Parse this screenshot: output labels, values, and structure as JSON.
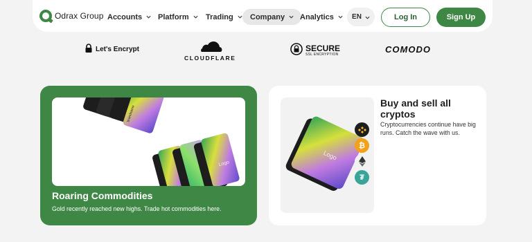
{
  "brand": {
    "name": "Odrax Group"
  },
  "nav": {
    "items": [
      {
        "label": "Accounts",
        "active": false
      },
      {
        "label": "Platform",
        "active": false
      },
      {
        "label": "Trading",
        "active": false
      },
      {
        "label": "Company",
        "active": true
      },
      {
        "label": "Analytics",
        "active": false
      }
    ],
    "language": "EN",
    "login_label": "Log In",
    "signup_label": "Sign Up"
  },
  "partners": {
    "letsencrypt": "Let's Encrypt",
    "cloudflare": "CLOUDFLARE",
    "secure_big": "SECURE",
    "secure_small": "SSL ENCRYPTION",
    "comodo": "COMODO"
  },
  "cards": {
    "commodities": {
      "title": "Roaring Commodities",
      "description": "Gold recently reached new highs. Trade hot commodities here."
    },
    "cryptos": {
      "title": "Buy and sell all cryptos",
      "description": "Cryptocurrencies continue have big runs. Catch the wave with us."
    },
    "card_text": {
      "brand": "brandname",
      "logo": "Logo",
      "credit": "Credit"
    }
  },
  "colors": {
    "accent": "#3f8745",
    "background": "#f3f3f3",
    "card_gradient": [
      "#3ba55c",
      "#d6e03a",
      "#c07be0",
      "#6a4fd0"
    ]
  }
}
